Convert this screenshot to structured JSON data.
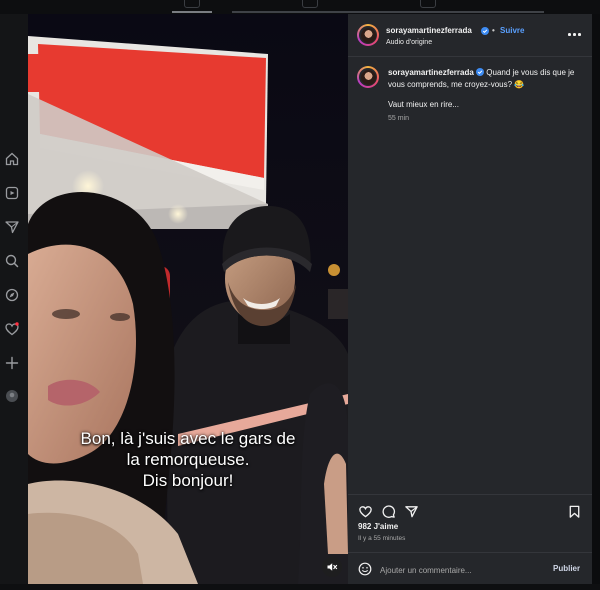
{
  "colors": {
    "panel_bg": "#25272b",
    "accent_link": "#5aa0ff",
    "verified_badge": "#3d8bf2",
    "text_primary": "#f1f1f1",
    "text_secondary": "#a8a8a8",
    "notification_dot": "#ff3040"
  },
  "left_rail": {
    "icons": [
      "home-icon",
      "reels-icon",
      "messages-icon",
      "search-icon",
      "explore-icon",
      "notifications-icon",
      "create-icon",
      "profile-avatar"
    ]
  },
  "video": {
    "subtitle": "Bon, là j'suis avec le gars de\nla remorqueuse.\nDis bonjour!",
    "mute_icon": "speaker-muted-icon"
  },
  "post": {
    "username": "sorayamartinezferrada",
    "separator": "•",
    "follow_label": "Suivre",
    "audio_label": "Audio d'origine",
    "caption": "Quand je vous dis que je vous comprends, me croyez-vous? 😂",
    "caption_line2": "Vaut mieux en rire...",
    "caption_time": "55 min",
    "likes": "982 J'aime",
    "posted_ago": "Il y a 55 minutes",
    "comment_placeholder": "Ajouter un commentaire...",
    "publish_label": "Publier"
  }
}
